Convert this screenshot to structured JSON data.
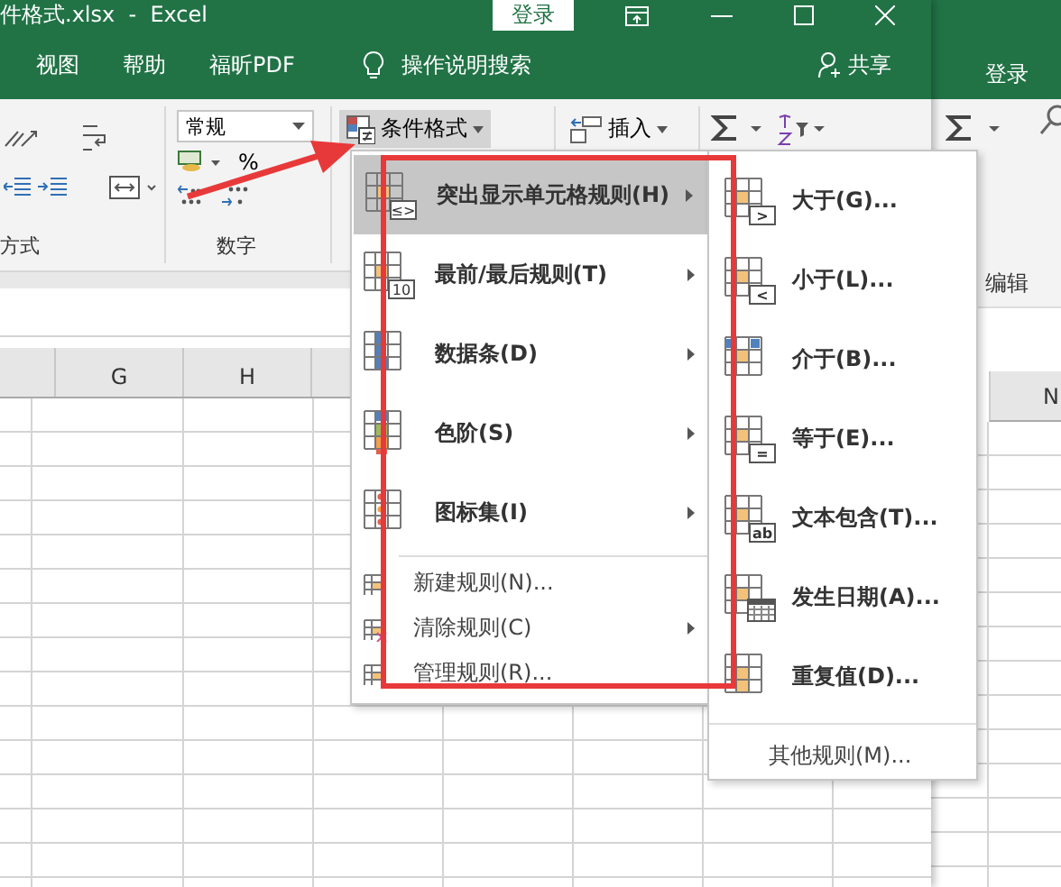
{
  "window": {
    "title": "件格式.xlsx  -  Excel",
    "login": "登录"
  },
  "tabs": [
    {
      "label": "视图",
      "selected": false
    },
    {
      "label": "帮助",
      "selected": false
    },
    {
      "label": "福昕PDF",
      "selected": false
    }
  ],
  "tell_me": "操作说明搜索",
  "share": "共享",
  "ribbon": {
    "alignment_label": "方式",
    "number_format": "常规",
    "percent": "%",
    "number_label": "数字",
    "conditional_format": {
      "label": "条件格式",
      "expanded": true
    },
    "insert": "插入"
  },
  "columns": [
    "G",
    "H"
  ],
  "menu": {
    "items": [
      {
        "kind": "large",
        "label": "突出显示单元格规则(H)",
        "badge": "≤>",
        "submenu": true,
        "selected": true
      },
      {
        "kind": "large",
        "label": "最前/最后规则(T)",
        "badge": "10",
        "submenu": true,
        "selected": false
      },
      {
        "kind": "large",
        "label": "数据条(D)",
        "submenu": true,
        "selected": false
      },
      {
        "kind": "large",
        "label": "色阶(S)",
        "submenu": true,
        "selected": false
      },
      {
        "kind": "large",
        "label": "图标集(I)",
        "submenu": true,
        "selected": false
      },
      {
        "kind": "small",
        "label": "新建规则(N)...",
        "submenu": false,
        "selected": false
      },
      {
        "kind": "small",
        "label": "清除规则(C)",
        "submenu": true,
        "selected": false
      },
      {
        "kind": "small",
        "label": "管理规则(R)...",
        "submenu": false,
        "selected": false
      }
    ]
  },
  "submenu": {
    "items": [
      {
        "label": "大于(G)...",
        "badge": ">"
      },
      {
        "label": "小于(L)...",
        "badge": "<"
      },
      {
        "label": "介于(B)..."
      },
      {
        "label": "等于(E)...",
        "badge": "="
      },
      {
        "label": "文本包含(T)...",
        "badge": "ab"
      },
      {
        "label": "发生日期(A)..."
      },
      {
        "label": "重复值(D)..."
      }
    ],
    "footer": "其他规则(M)..."
  },
  "back_window": {
    "login": "登录",
    "group_label": "编辑",
    "column": "N"
  }
}
